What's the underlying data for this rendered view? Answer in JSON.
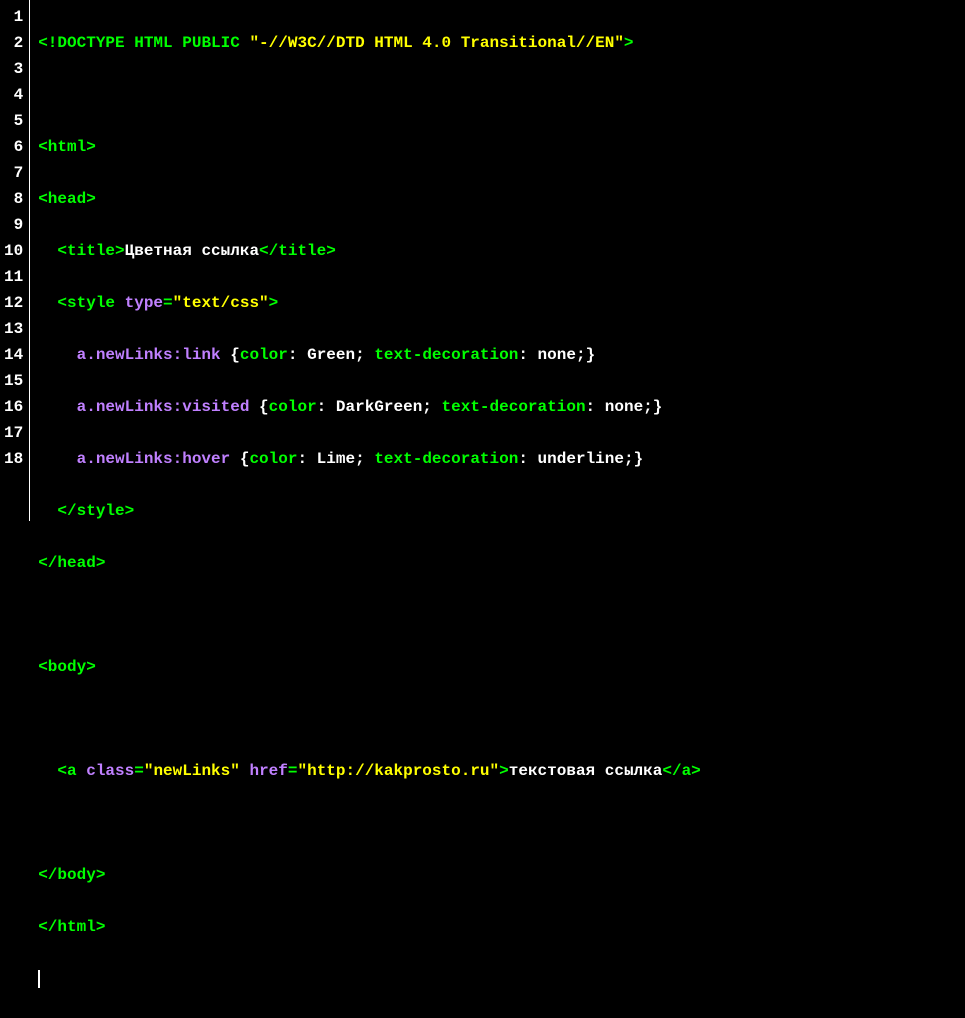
{
  "lineNumbers": [
    "1",
    "2",
    "3",
    "4",
    "5",
    "6",
    "7",
    "8",
    "9",
    "10",
    "11",
    "12",
    "13",
    "14",
    "15",
    "16",
    "17",
    "18"
  ],
  "code": {
    "l1": {
      "doctype_open": "<!DOCTYPE",
      "doctype_kw": " HTML PUBLIC ",
      "doctype_str": "\"-//W3C//DTD HTML 4.0 Transitional//EN\"",
      "doctype_close": ">"
    },
    "l3": {
      "tag": "<html>"
    },
    "l4": {
      "tag": "<head>"
    },
    "l5": {
      "indent": "  ",
      "open": "<title>",
      "text": "Цветная ссылка",
      "close": "</title>"
    },
    "l6": {
      "indent": "  ",
      "tag_open": "<style",
      "sp": " ",
      "attr": "type",
      "eq": "=",
      "val": "\"text/css\"",
      "tag_close": ">"
    },
    "l7": {
      "indent": "    ",
      "sel": "a.newLinks:link",
      "sp": " ",
      "ob": "{",
      "p1": "color",
      "c1": ":",
      "v1": " Green",
      "sc1": ";",
      "sp2": " ",
      "p2": "text-decoration",
      "c2": ":",
      "v2": " none",
      "sc2": ";",
      "cb": "}"
    },
    "l8": {
      "indent": "    ",
      "sel": "a.newLinks:visited",
      "sp": " ",
      "ob": "{",
      "p1": "color",
      "c1": ":",
      "v1": " DarkGreen",
      "sc1": ";",
      "sp2": " ",
      "p2": "text-decoration",
      "c2": ":",
      "v2": " none",
      "sc2": ";",
      "cb": "}"
    },
    "l9": {
      "indent": "    ",
      "sel": "a.newLinks:hover",
      "sp": " ",
      "ob": "{",
      "p1": "color",
      "c1": ":",
      "v1": " Lime",
      "sc1": ";",
      "sp2": " ",
      "p2": "text-decoration",
      "c2": ":",
      "v2": " underline",
      "sc2": ";",
      "cb": "}"
    },
    "l10": {
      "indent": "  ",
      "tag": "</style>"
    },
    "l11": {
      "tag": "</head>"
    },
    "l13": {
      "tag": "<body>"
    },
    "l15": {
      "indent": "  ",
      "tag_open": "<a",
      "sp1": " ",
      "a1": "class",
      "eq1": "=",
      "v1": "\"newLinks\"",
      "sp2": " ",
      "a2": "href",
      "eq2": "=",
      "v2": "\"http://kakprosto.ru\"",
      "tag_close": ">",
      "text": "текстовая ссылка",
      "close": "</a>"
    },
    "l17": {
      "tag": "</body>"
    },
    "l18": {
      "tag": "</html>"
    }
  }
}
